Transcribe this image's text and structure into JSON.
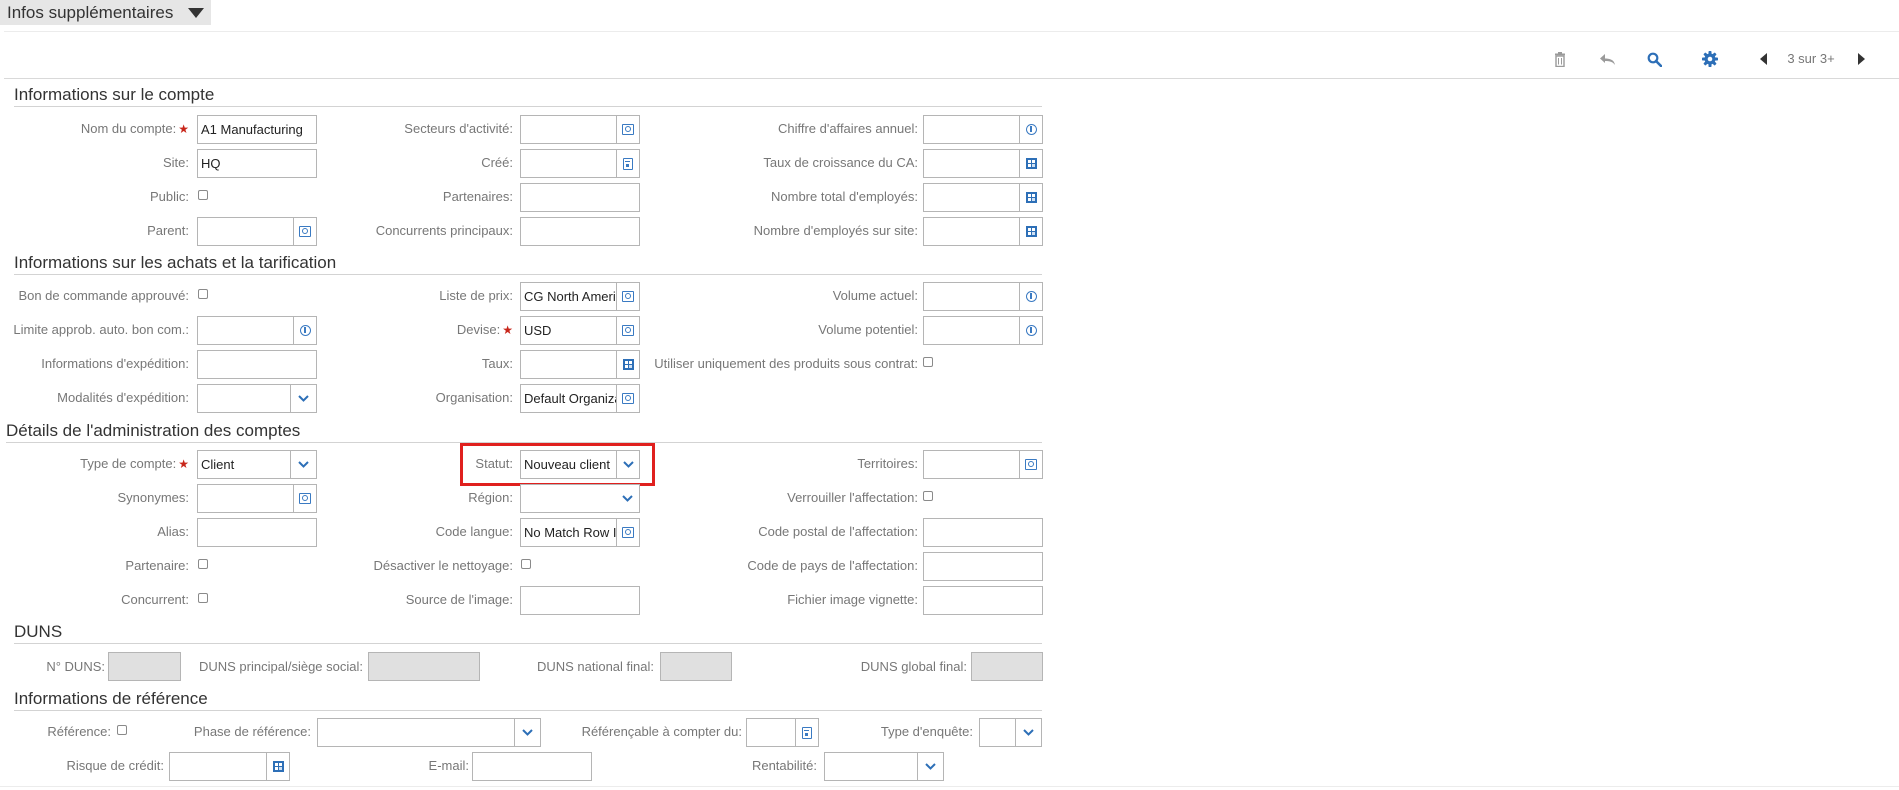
{
  "header": {
    "collapsible_title": "Infos supplémentaires"
  },
  "toolbar": {
    "pager": "3 sur 3+"
  },
  "sections": {
    "compte": "Informations sur le compte",
    "achats": "Informations sur les achats et la tarification",
    "admin": "Détails de l'administration des comptes",
    "duns": "DUNS",
    "reference": "Informations de référence"
  },
  "compte": {
    "nom_label": "Nom du compte:",
    "nom_value": "A1 Manufacturing",
    "site_label": "Site:",
    "site_value": "HQ",
    "public_label": "Public:",
    "parent_label": "Parent:",
    "secteurs_label": "Secteurs d'activité:",
    "cree_label": "Créé:",
    "partenaires_label": "Partenaires:",
    "concurrents_label": "Concurrents principaux:",
    "ca_label": "Chiffre d'affaires annuel:",
    "taux_ca_label": "Taux de croissance du CA:",
    "employes_label": "Nombre total d'employés:",
    "employes_site_label": "Nombre d'employés sur site:"
  },
  "achats": {
    "bon_label": "Bon de commande approuvé:",
    "limite_label": "Limite approb. auto. bon com.:",
    "expedition_label": "Informations d'expédition:",
    "modalites_label": "Modalités d'expédition:",
    "liste_label": "Liste de prix:",
    "liste_value": "CG North America",
    "devise_label": "Devise:",
    "devise_value": "USD",
    "taux_label": "Taux:",
    "org_label": "Organisation:",
    "org_value": "Default Organization",
    "vol_actuel_label": "Volume actuel:",
    "vol_potentiel_label": "Volume potentiel:",
    "contrat_label": "Utiliser uniquement des produits sous contrat:"
  },
  "admin": {
    "type_label": "Type de compte:",
    "type_value": "Client",
    "synonymes_label": "Synonymes:",
    "alias_label": "Alias:",
    "partenaire_label": "Partenaire:",
    "concurrent_label": "Concurrent:",
    "statut_label": "Statut:",
    "statut_value": "Nouveau client",
    "region_label": "Région:",
    "code_langue_label": "Code langue:",
    "code_langue_value": "No Match Row Id",
    "nettoyage_label": "Désactiver le nettoyage:",
    "source_label": "Source de l'image:",
    "territoires_label": "Territoires:",
    "verrouiller_label": "Verrouiller l'affectation:",
    "postal_label": "Code postal de l'affectation:",
    "pays_label": "Code de pays de l'affectation:",
    "vignette_label": "Fichier image vignette:"
  },
  "duns": {
    "num_label": "N° DUNS:",
    "principal_label": "DUNS principal/siège social:",
    "national_label": "DUNS national final:",
    "global_label": "DUNS global final:"
  },
  "reference": {
    "ref_label": "Référence:",
    "phase_label": "Phase de référence:",
    "referencable_label": "Référençable à compter du:",
    "enquete_label": "Type d'enquête:",
    "risque_label": "Risque de crédit:",
    "email_label": "E-mail:",
    "rentabilite_label": "Rentabilité:"
  },
  "colors": {
    "accent": "#2d6fb7",
    "highlight": "#e0201e",
    "required": "#c8261a"
  }
}
